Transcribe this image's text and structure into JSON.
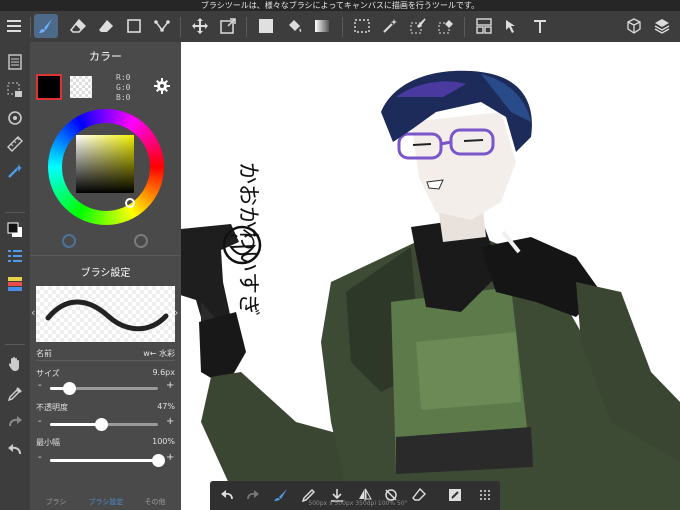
{
  "tip": "ブラシツールは、様々なブラシによってキャンバスに描画を行うツールです。",
  "toolbar": {
    "menu": "menu-icon",
    "tools": [
      "brush",
      "eraser",
      "shape",
      "fill",
      "move",
      "transform",
      "fill-color",
      "bucket",
      "gradient",
      "select",
      "magic-wand",
      "select-pen",
      "select-eraser",
      "frame",
      "operation",
      "text"
    ],
    "right": [
      "materials",
      "layers"
    ]
  },
  "left_rail": [
    "pages",
    "select-all",
    "snap",
    "ruler",
    "filter",
    "color",
    "brush-list",
    "layer",
    "hand",
    "eyedropper",
    "redo",
    "undo"
  ],
  "color_panel": {
    "title": "カラー",
    "r": "R:0",
    "g": "G:0",
    "b": "B:0",
    "fg_color": "#000000"
  },
  "brush_panel": {
    "title": "ブラシ設定",
    "name_label": "名前",
    "name_value": "w← 水彩",
    "size_label": "サイズ",
    "size_value": "9.6px",
    "size_fraction": 0.18,
    "opacity_label": "不透明度",
    "opacity_value": "47%",
    "opacity_fraction": 0.47,
    "min_width_label": "最小幅",
    "min_width_value": "100%",
    "min_width_fraction": 1.0,
    "minus": "-",
    "plus": "+",
    "tabs": [
      "ブラシ",
      "ブラシ設定",
      "その他"
    ]
  },
  "canvas": {
    "handwriting": "かおかわいすぎ",
    "info": "500px x 500px 350dpi 100% 50°"
  },
  "quick_bar": [
    "undo",
    "redo",
    "brush",
    "pen",
    "download",
    "flip",
    "rotate-lock",
    "eraser",
    "smooth",
    "grid"
  ]
}
